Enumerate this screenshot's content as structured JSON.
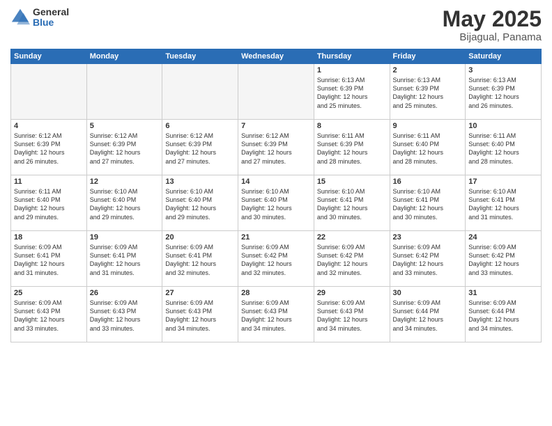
{
  "logo": {
    "general": "General",
    "blue": "Blue"
  },
  "title": "May 2025",
  "subtitle": "Bijagual, Panama",
  "days_header": [
    "Sunday",
    "Monday",
    "Tuesday",
    "Wednesday",
    "Thursday",
    "Friday",
    "Saturday"
  ],
  "weeks": [
    [
      {
        "num": "",
        "info": ""
      },
      {
        "num": "",
        "info": ""
      },
      {
        "num": "",
        "info": ""
      },
      {
        "num": "",
        "info": ""
      },
      {
        "num": "1",
        "info": "Sunrise: 6:13 AM\nSunset: 6:39 PM\nDaylight: 12 hours\nand 25 minutes."
      },
      {
        "num": "2",
        "info": "Sunrise: 6:13 AM\nSunset: 6:39 PM\nDaylight: 12 hours\nand 25 minutes."
      },
      {
        "num": "3",
        "info": "Sunrise: 6:13 AM\nSunset: 6:39 PM\nDaylight: 12 hours\nand 26 minutes."
      }
    ],
    [
      {
        "num": "4",
        "info": "Sunrise: 6:12 AM\nSunset: 6:39 PM\nDaylight: 12 hours\nand 26 minutes."
      },
      {
        "num": "5",
        "info": "Sunrise: 6:12 AM\nSunset: 6:39 PM\nDaylight: 12 hours\nand 27 minutes."
      },
      {
        "num": "6",
        "info": "Sunrise: 6:12 AM\nSunset: 6:39 PM\nDaylight: 12 hours\nand 27 minutes."
      },
      {
        "num": "7",
        "info": "Sunrise: 6:12 AM\nSunset: 6:39 PM\nDaylight: 12 hours\nand 27 minutes."
      },
      {
        "num": "8",
        "info": "Sunrise: 6:11 AM\nSunset: 6:39 PM\nDaylight: 12 hours\nand 28 minutes."
      },
      {
        "num": "9",
        "info": "Sunrise: 6:11 AM\nSunset: 6:40 PM\nDaylight: 12 hours\nand 28 minutes."
      },
      {
        "num": "10",
        "info": "Sunrise: 6:11 AM\nSunset: 6:40 PM\nDaylight: 12 hours\nand 28 minutes."
      }
    ],
    [
      {
        "num": "11",
        "info": "Sunrise: 6:11 AM\nSunset: 6:40 PM\nDaylight: 12 hours\nand 29 minutes."
      },
      {
        "num": "12",
        "info": "Sunrise: 6:10 AM\nSunset: 6:40 PM\nDaylight: 12 hours\nand 29 minutes."
      },
      {
        "num": "13",
        "info": "Sunrise: 6:10 AM\nSunset: 6:40 PM\nDaylight: 12 hours\nand 29 minutes."
      },
      {
        "num": "14",
        "info": "Sunrise: 6:10 AM\nSunset: 6:40 PM\nDaylight: 12 hours\nand 30 minutes."
      },
      {
        "num": "15",
        "info": "Sunrise: 6:10 AM\nSunset: 6:41 PM\nDaylight: 12 hours\nand 30 minutes."
      },
      {
        "num": "16",
        "info": "Sunrise: 6:10 AM\nSunset: 6:41 PM\nDaylight: 12 hours\nand 30 minutes."
      },
      {
        "num": "17",
        "info": "Sunrise: 6:10 AM\nSunset: 6:41 PM\nDaylight: 12 hours\nand 31 minutes."
      }
    ],
    [
      {
        "num": "18",
        "info": "Sunrise: 6:09 AM\nSunset: 6:41 PM\nDaylight: 12 hours\nand 31 minutes."
      },
      {
        "num": "19",
        "info": "Sunrise: 6:09 AM\nSunset: 6:41 PM\nDaylight: 12 hours\nand 31 minutes."
      },
      {
        "num": "20",
        "info": "Sunrise: 6:09 AM\nSunset: 6:41 PM\nDaylight: 12 hours\nand 32 minutes."
      },
      {
        "num": "21",
        "info": "Sunrise: 6:09 AM\nSunset: 6:42 PM\nDaylight: 12 hours\nand 32 minutes."
      },
      {
        "num": "22",
        "info": "Sunrise: 6:09 AM\nSunset: 6:42 PM\nDaylight: 12 hours\nand 32 minutes."
      },
      {
        "num": "23",
        "info": "Sunrise: 6:09 AM\nSunset: 6:42 PM\nDaylight: 12 hours\nand 33 minutes."
      },
      {
        "num": "24",
        "info": "Sunrise: 6:09 AM\nSunset: 6:42 PM\nDaylight: 12 hours\nand 33 minutes."
      }
    ],
    [
      {
        "num": "25",
        "info": "Sunrise: 6:09 AM\nSunset: 6:43 PM\nDaylight: 12 hours\nand 33 minutes."
      },
      {
        "num": "26",
        "info": "Sunrise: 6:09 AM\nSunset: 6:43 PM\nDaylight: 12 hours\nand 33 minutes."
      },
      {
        "num": "27",
        "info": "Sunrise: 6:09 AM\nSunset: 6:43 PM\nDaylight: 12 hours\nand 34 minutes."
      },
      {
        "num": "28",
        "info": "Sunrise: 6:09 AM\nSunset: 6:43 PM\nDaylight: 12 hours\nand 34 minutes."
      },
      {
        "num": "29",
        "info": "Sunrise: 6:09 AM\nSunset: 6:43 PM\nDaylight: 12 hours\nand 34 minutes."
      },
      {
        "num": "30",
        "info": "Sunrise: 6:09 AM\nSunset: 6:44 PM\nDaylight: 12 hours\nand 34 minutes."
      },
      {
        "num": "31",
        "info": "Sunrise: 6:09 AM\nSunset: 6:44 PM\nDaylight: 12 hours\nand 34 minutes."
      }
    ]
  ]
}
